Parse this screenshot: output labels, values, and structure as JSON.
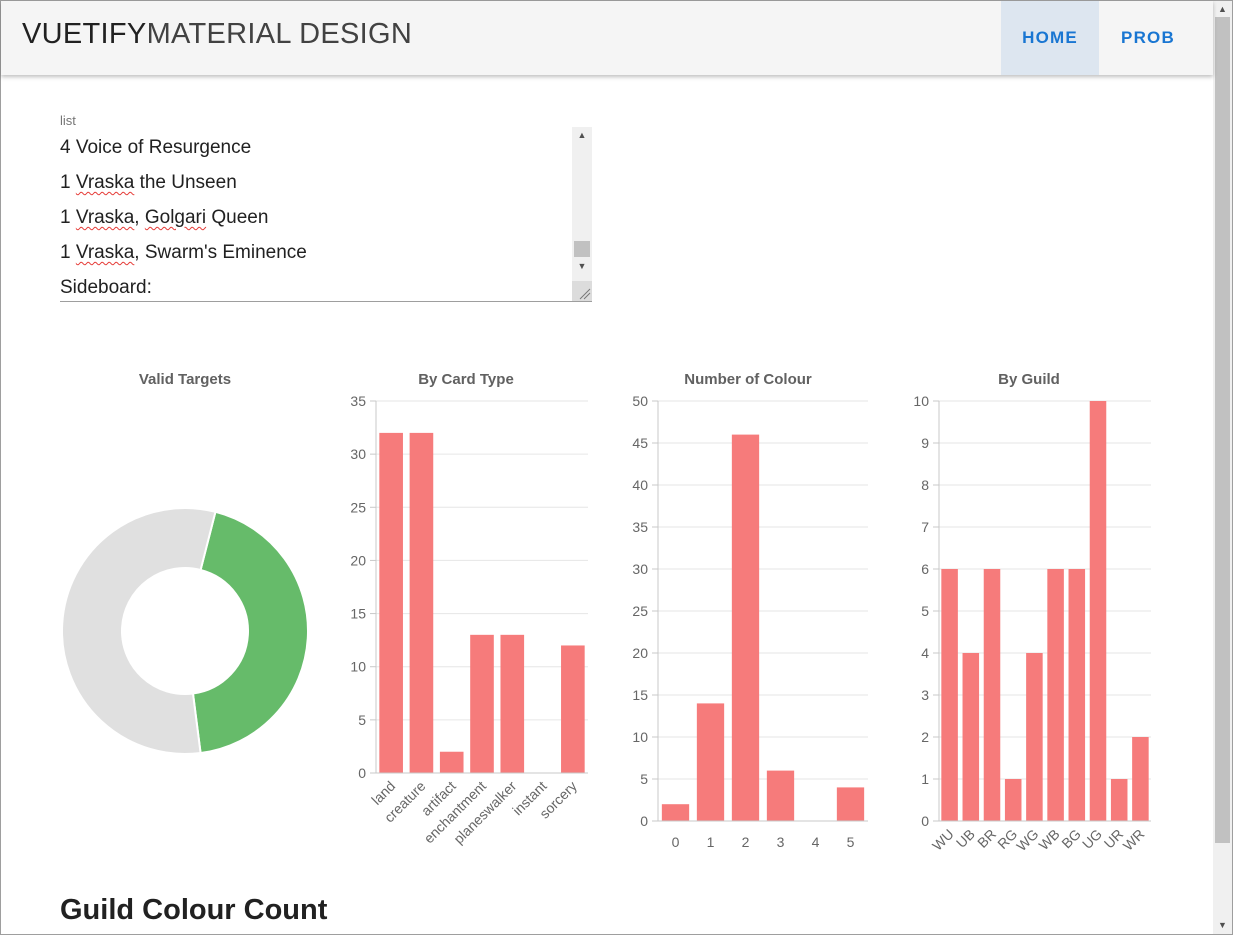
{
  "app": {
    "brand_bold": "VUETIFY",
    "brand_light": "MATERIAL DESIGN",
    "nav": [
      {
        "label": "HOME",
        "active": true
      },
      {
        "label": "PROB",
        "active": false
      }
    ]
  },
  "list_field": {
    "label": "list",
    "lines": [
      {
        "parts": [
          {
            "t": "4 Voice of Resurgence"
          }
        ]
      },
      {
        "parts": [
          {
            "t": "1 "
          },
          {
            "t": "Vraska",
            "misspelled": true
          },
          {
            "t": " the Unseen"
          }
        ]
      },
      {
        "parts": [
          {
            "t": "1 "
          },
          {
            "t": "Vraska",
            "misspelled": true
          },
          {
            "t": ", "
          },
          {
            "t": "Golgari",
            "misspelled": true
          },
          {
            "t": " Queen"
          }
        ]
      },
      {
        "parts": [
          {
            "t": "1 "
          },
          {
            "t": "Vraska",
            "misspelled": true
          },
          {
            "t": ", Swarm's Eminence"
          }
        ]
      },
      {
        "parts": [
          {
            "t": "Sideboard:"
          }
        ]
      }
    ]
  },
  "colors": {
    "bar": "#f67b7b",
    "donut_green": "#66bb6a",
    "donut_grey": "#e0e0e0",
    "accent": "#1976d2"
  },
  "chart_data": [
    {
      "type": "pie",
      "title": "Valid Targets",
      "donut": true,
      "slices": [
        {
          "value": 0.44,
          "color": "#66bb6a"
        },
        {
          "value": 0.56,
          "color": "#e0e0e0"
        }
      ]
    },
    {
      "type": "bar",
      "title": "By Card Type",
      "categories": [
        "land",
        "creature",
        "artifact",
        "enchantment",
        "planeswalker",
        "instant",
        "sorcery"
      ],
      "values": [
        32,
        32,
        2,
        13,
        13,
        0,
        12
      ],
      "ylim": [
        0,
        35
      ],
      "yticks": [
        0,
        5,
        10,
        15,
        20,
        25,
        30,
        35
      ],
      "rotated_labels": true,
      "grid": true
    },
    {
      "type": "bar",
      "title": "Number of Colour",
      "categories": [
        "0",
        "1",
        "2",
        "3",
        "4",
        "5"
      ],
      "values": [
        2,
        14,
        46,
        6,
        0,
        4
      ],
      "ylim": [
        0,
        50
      ],
      "yticks": [
        0,
        5,
        10,
        15,
        20,
        25,
        30,
        35,
        40,
        45,
        50
      ],
      "rotated_labels": false,
      "grid": true
    },
    {
      "type": "bar",
      "title": "By Guild",
      "categories": [
        "WU",
        "UB",
        "BR",
        "RG",
        "WG",
        "WB",
        "BG",
        "UG",
        "UR",
        "WR"
      ],
      "values": [
        6,
        4,
        6,
        1,
        4,
        6,
        6,
        10,
        1,
        2
      ],
      "ylim": [
        0,
        10
      ],
      "yticks": [
        0,
        1,
        2,
        3,
        4,
        5,
        6,
        7,
        8,
        9,
        10
      ],
      "rotated_labels": true,
      "grid": true
    }
  ],
  "section": {
    "heading": "Guild Colour Count"
  }
}
